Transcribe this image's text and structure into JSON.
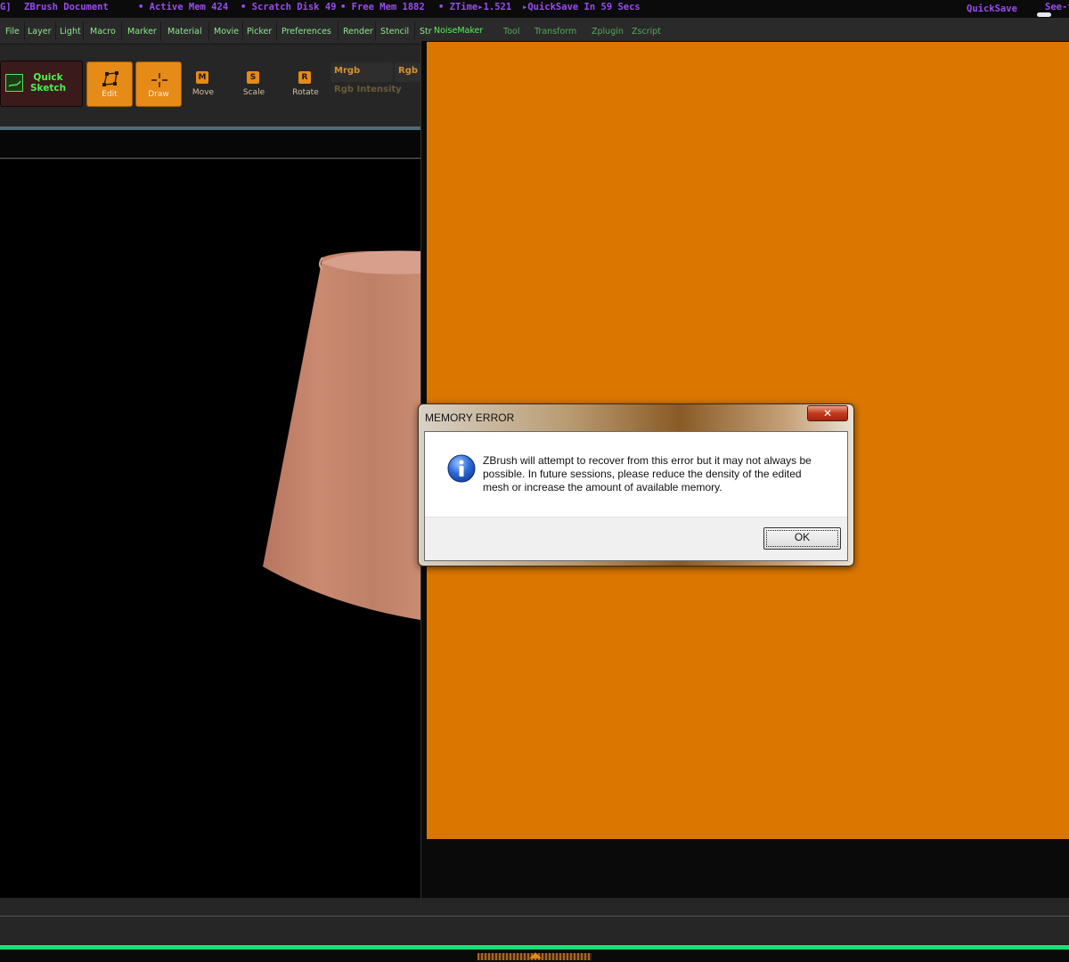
{
  "statusbar": {
    "left_fragment": "G]",
    "document": "ZBrush Document",
    "active_mem": "• Active Mem 424",
    "scratch_disk": "• Scratch Disk 49",
    "free_mem": "• Free Mem 1882",
    "ztime": "• ZTime▸1.521",
    "quicksave_timer": "▸QuickSave In 59 Secs",
    "quicksave_btn": "QuickSave",
    "see_through": "See-t",
    "text_color": "#9b4cf0"
  },
  "menubar": {
    "items": [
      "File",
      "Layer",
      "Light",
      "Macro",
      "Marker",
      "Material",
      "Movie",
      "Picker",
      "Preferences",
      "Render",
      "Stencil",
      "Str",
      "NoiseMaker",
      "Tool",
      "Transform",
      "Zplugin",
      "Zscript"
    ],
    "text_color": "#8ee88e"
  },
  "toolbar": {
    "quick_sketch": "Quick Sketch",
    "edit": "Edit",
    "draw": "Draw",
    "move": "Move",
    "move_key": "M",
    "scale": "Scale",
    "scale_key": "S",
    "rotate": "Rotate",
    "rotate_key": "R",
    "mrgb": "Mrgb",
    "rgb": "Rgb",
    "rgb_intensity": "Rgb Intensity",
    "accent_color": "#e68a18"
  },
  "dialog": {
    "title": "MEMORY ERROR",
    "close_glyph": "✕",
    "message": "ZBrush will attempt to recover from this error but it may not always be possible. In future sessions, please reduce the density of the edited mesh or increase the amount of available memory.",
    "ok_label": "OK",
    "icon": "info-icon"
  },
  "colors": {
    "orange_panel": "#db7600",
    "mesh": "#c98a70",
    "bottom_bar": "#18e07a"
  },
  "bottom": {
    "arrows_glyph": "◢◣"
  }
}
